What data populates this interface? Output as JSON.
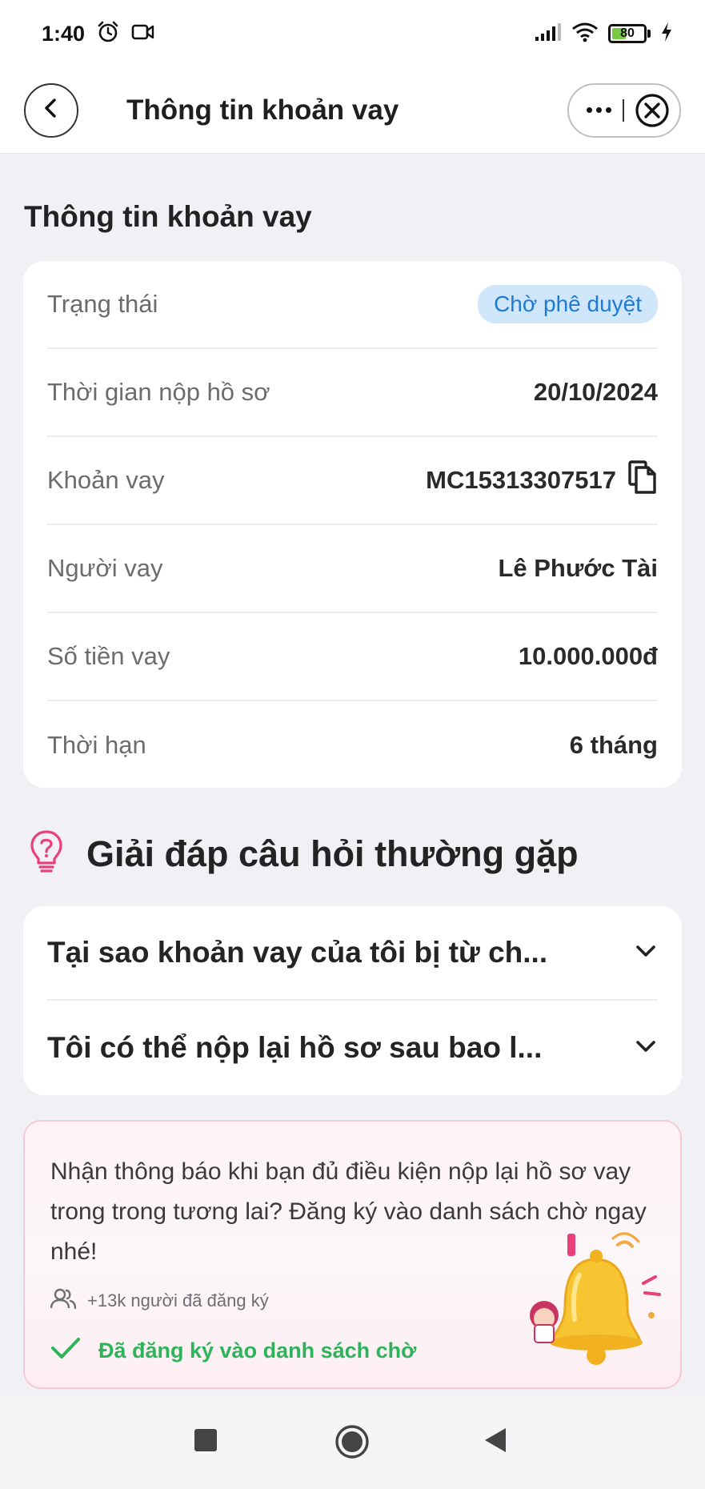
{
  "status_bar": {
    "time": "1:40",
    "battery": "80",
    "icons": [
      "alarm-icon",
      "video-icon",
      "signal-icon",
      "wifi-icon",
      "battery-icon",
      "charging-icon"
    ]
  },
  "header": {
    "title": "Thông tin khoản vay",
    "icons": [
      "back-arrow-icon",
      "more-icon",
      "close-icon"
    ]
  },
  "loan_info": {
    "section_title": "Thông tin khoản vay",
    "rows": [
      {
        "label": "Trạng thái",
        "value": "Chờ phê duyệt"
      },
      {
        "label": "Thời gian nộp hồ sơ",
        "value": "20/10/2024"
      },
      {
        "label": "Khoản vay",
        "value": "MC15313307517"
      },
      {
        "label": "Người vay",
        "value": "Lê Phước Tài"
      },
      {
        "label": "Số tiền vay",
        "value": "10.000.000đ"
      },
      {
        "label": "Thời hạn",
        "value": "6 tháng"
      }
    ],
    "colors": {
      "badge_bg": "#cfe6fb",
      "badge_text": "#1f7ad4"
    }
  },
  "faq": {
    "title": "Giải đáp câu hỏi thường gặp",
    "items": [
      {
        "question": "Tại sao khoản vay của tôi bị từ ch..."
      },
      {
        "question": "Tôi có thể nộp lại hồ sơ sau bao l..."
      }
    ]
  },
  "waitlist": {
    "message": "Nhận thông báo khi bạn đủ điều kiện nộp lại hồ sơ vay trong trong tương lai? Đăng ký vào danh sách chờ ngay nhé!",
    "count": "+13k người đã đăng ký",
    "status": "Đã đăng ký vào danh sách chờ",
    "colors": {
      "status": "#2fb35a",
      "border": "#f4c9d8"
    }
  },
  "nav_bar": {
    "icons": [
      "recents-square-icon",
      "home-circle-icon",
      "back-triangle-icon"
    ]
  }
}
